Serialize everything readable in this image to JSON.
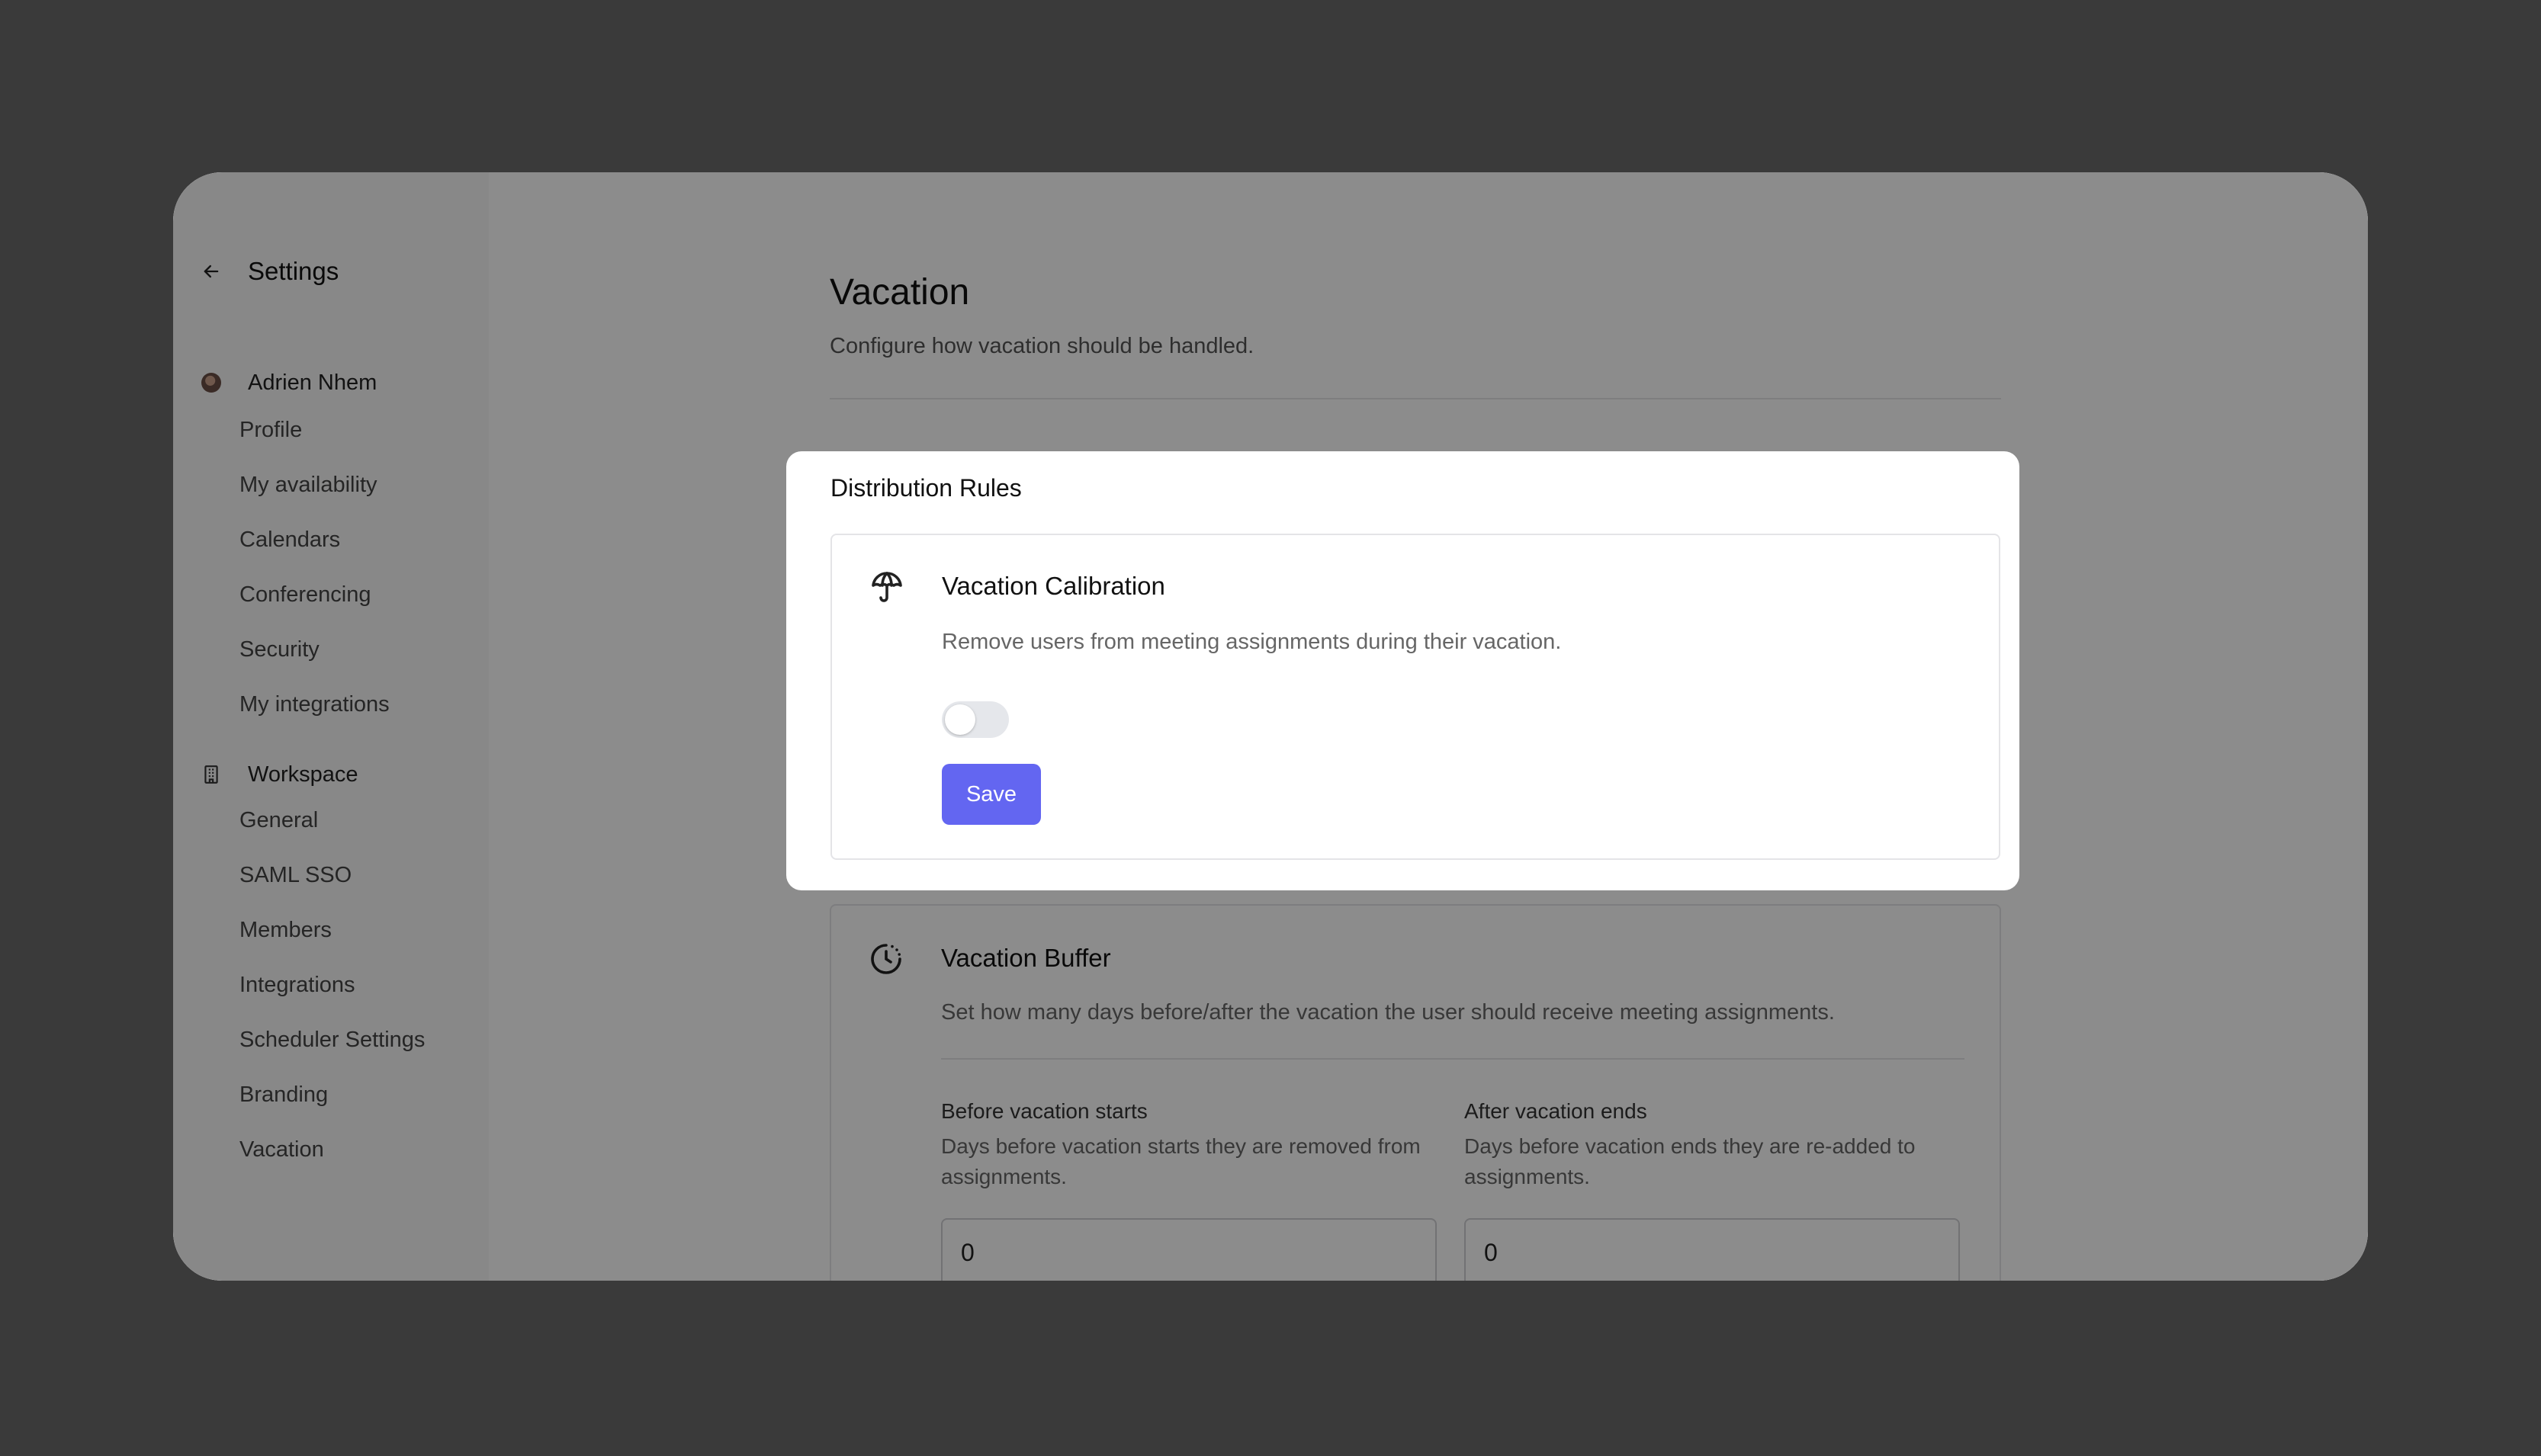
{
  "sidebar": {
    "back_title": "Settings",
    "user_name": "Adrien Nhem",
    "user_items": [
      "Profile",
      "My availability",
      "Calendars",
      "Conferencing",
      "Security",
      "My integrations"
    ],
    "workspace_title": "Workspace",
    "workspace_items": [
      "General",
      "SAML SSO",
      "Members",
      "Integrations",
      "Scheduler Settings",
      "Branding",
      "Vacation"
    ]
  },
  "page": {
    "title": "Vacation",
    "subtitle": "Configure how vacation should be handled."
  },
  "modal": {
    "title": "Distribution Rules",
    "card_title": "Vacation Calibration",
    "card_desc": "Remove users from meeting assignments during their vacation.",
    "toggle_on": false,
    "save_label": "Save"
  },
  "buffer": {
    "title": "Vacation Buffer",
    "desc": "Set how many days before/after the vacation the user should receive meeting assignments.",
    "before_label": "Before vacation starts",
    "before_help": "Days before vacation starts they are removed from assignments.",
    "before_value": "0",
    "after_label": "After vacation ends",
    "after_help": "Days before vacation ends they are re-added to assignments.",
    "after_value": "0"
  },
  "colors": {
    "accent": "#6366f1",
    "backdrop": "#3a3a3a"
  }
}
